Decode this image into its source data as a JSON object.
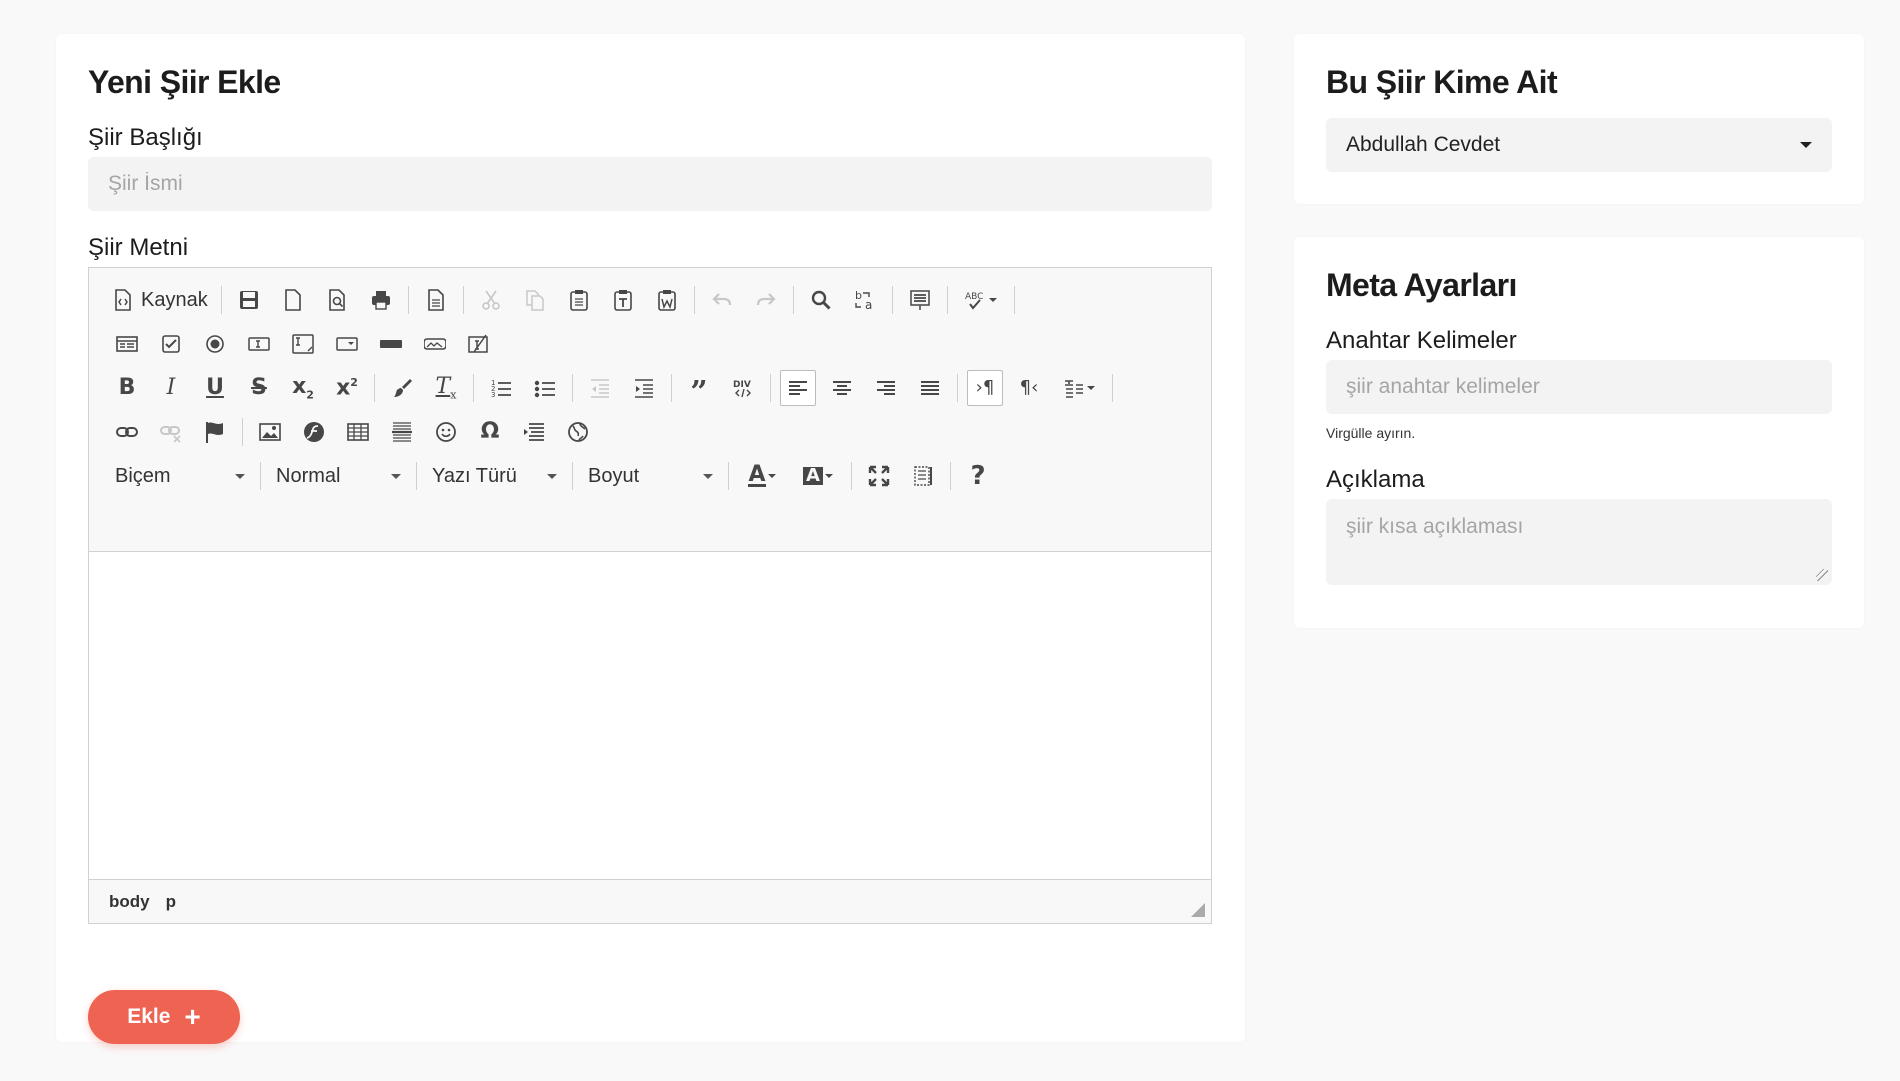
{
  "main": {
    "title": "Yeni Şiir Ekle",
    "title_label": "Şiir Başlığı",
    "title_placeholder": "Şiir İsmi",
    "text_label": "Şiir Metni",
    "editor": {
      "source_label": "Kaynak",
      "format_combo": "Biçem",
      "paragraph_combo": "Normal",
      "font_combo": "Yazı Türü",
      "size_combo": "Boyut",
      "status_path": [
        "body",
        "p"
      ]
    },
    "add_button": "Ekle",
    "accent_color": "#ee6352"
  },
  "owner": {
    "title": "Bu Şiir Kime Ait",
    "selected": "Abdullah Cevdet"
  },
  "meta": {
    "title": "Meta Ayarları",
    "keywords_label": "Anahtar Kelimeler",
    "keywords_placeholder": "şiir anahtar kelimeler",
    "keywords_hint": "Virgülle ayırın.",
    "description_label": "Açıklama",
    "description_placeholder": "şiir kısa açıklaması"
  }
}
